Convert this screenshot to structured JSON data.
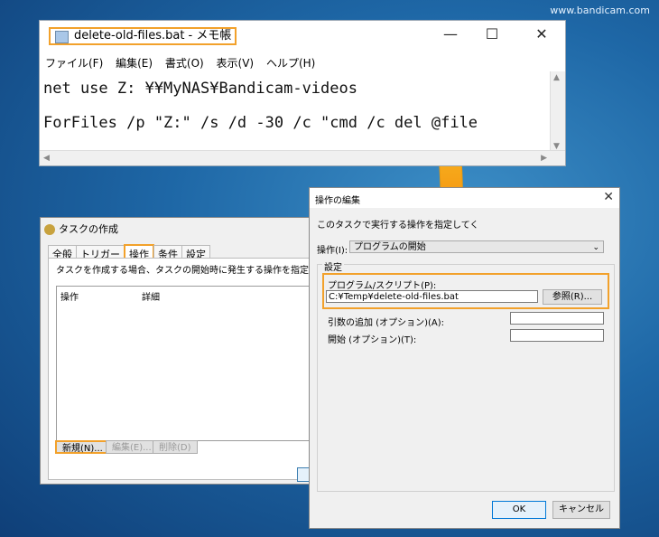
{
  "watermark": "www.bandicam.com",
  "notepad": {
    "title": "delete-old-files.bat - メモ帳",
    "controls": {
      "minimize": "—",
      "maximize": "☐",
      "close": "✕"
    },
    "menu": [
      "ファイル(F)",
      "編集(E)",
      "書式(O)",
      "表示(V)",
      "ヘルプ(H)"
    ],
    "lines": [
      "net use Z: ¥¥MyNAS¥Bandicam-videos",
      "ForFiles /p \"Z:\" /s /d -30 /c \"cmd /c del @file"
    ]
  },
  "task_dialog": {
    "title": "タスクの作成",
    "tabs": [
      "全般",
      "トリガー",
      "操作",
      "条件",
      "設定"
    ],
    "active_tab": "操作",
    "description": "タスクを作成する場合、タスクの開始時に発生する操作を指定する必要があります",
    "columns": [
      "操作",
      "詳細"
    ],
    "buttons": {
      "new": "新規(N)...",
      "edit": "編集(E)...",
      "delete": "削除(D)"
    }
  },
  "edit_dialog": {
    "title": "操作の編集",
    "close": "✕",
    "instruction": "このタスクで実行する操作を指定してく",
    "action_label": "操作(I):",
    "action_value": "プログラムの開始",
    "settings_label": "設定",
    "program_label": "プログラム/スクリプト(P):",
    "program_value": "C:¥Temp¥delete-old-files.bat",
    "browse": "参照(R)...",
    "args_label": "引数の追加 (オプション)(A):",
    "start_label": "開始 (オプション)(T):",
    "args_value": "",
    "start_value": "",
    "ok": "OK",
    "cancel": "キャンセル"
  },
  "colors": {
    "highlight": "#f2a12b",
    "arrow_top": "#ffd21f",
    "arrow_bottom": "#f07800"
  }
}
